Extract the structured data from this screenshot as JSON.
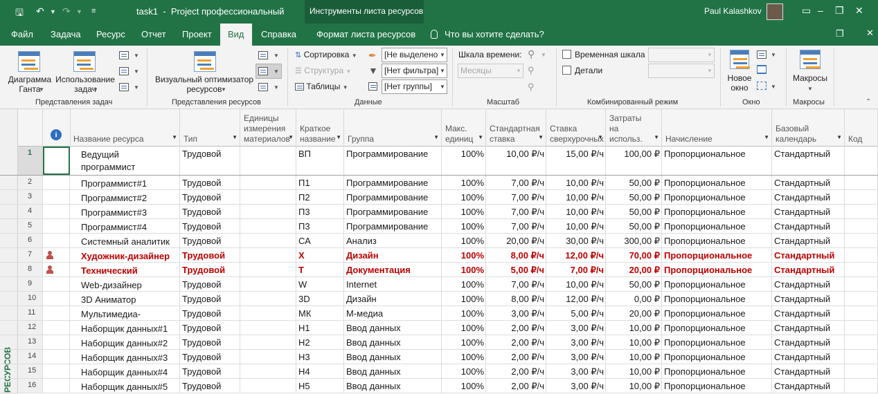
{
  "window": {
    "file_title": "task1",
    "separator": "-",
    "app_name": "Project профессиональный",
    "context_tab_header": "Инструменты листа ресурсов",
    "user_name": "Paul Kalashkov"
  },
  "tabs": [
    "Файл",
    "Задача",
    "Ресурс",
    "Отчет",
    "Проект",
    "Вид",
    "Справка",
    "Формат листа ресурсов"
  ],
  "active_tab": "Вид",
  "tell_me": "Что вы хотите сделать?",
  "ribbon": {
    "task_views": {
      "label": "Представления задач",
      "gantt": "Диаграмма\nГанта",
      "usage": "Использование\nзадач"
    },
    "resource_views": {
      "label": "Представления ресурсов",
      "team_planner": "Визуальный оптимизатор\nресурсов"
    },
    "data": {
      "label": "Данные",
      "sort": "Сортировка",
      "outline": "Структура",
      "tables": "Таблицы",
      "highlight_value": "[Не выделено",
      "filter_value": "[Нет фильтра]",
      "group_value": "[Нет группы]"
    },
    "zoom": {
      "label": "Масштаб",
      "timescale": "Шкала времени:",
      "timescale_value": "Месяцы"
    },
    "split_view": {
      "label": "Комбинированный режим",
      "timeline": "Временная шкала",
      "details": "Детали"
    },
    "window": {
      "label": "Окно",
      "new_window": "Новое\nокно"
    },
    "macros": {
      "label": "Макросы",
      "macros": "Макросы"
    }
  },
  "side_label": "РЕСУРСОВ",
  "columns": [
    "Название ресурса",
    "Тип",
    "Единицы\nизмерения\nматериалов",
    "Краткое\nназвание",
    "Группа",
    "Макс.\nединиц",
    "Стандартная\nставка",
    "Ставка\nсверхурочных",
    "Затраты\nна\nиспольз.",
    "Начисление",
    "Базовый\nкалендарь",
    "Код"
  ],
  "rows": [
    {
      "id": "1",
      "name": "Ведущий\nпрограммист",
      "type": "Трудовой",
      "short": "ВП",
      "group": "Программирование",
      "max": "100%",
      "std": "10,00 ₽/ч",
      "ovt": "15,00 ₽/ч",
      "cost": "100,00 ₽",
      "accrue": "Пропорциональное",
      "cal": "Стандартный",
      "over": false
    },
    {
      "id": "2",
      "name": "Программист#1",
      "type": "Трудовой",
      "short": "П1",
      "group": "Программирование",
      "max": "100%",
      "std": "7,00 ₽/ч",
      "ovt": "10,00 ₽/ч",
      "cost": "50,00 ₽",
      "accrue": "Пропорциональное",
      "cal": "Стандартный",
      "over": false
    },
    {
      "id": "3",
      "name": "Программист#2",
      "type": "Трудовой",
      "short": "П2",
      "group": "Программирование",
      "max": "100%",
      "std": "7,00 ₽/ч",
      "ovt": "10,00 ₽/ч",
      "cost": "50,00 ₽",
      "accrue": "Пропорциональное",
      "cal": "Стандартный",
      "over": false
    },
    {
      "id": "4",
      "name": "Программист#3",
      "type": "Трудовой",
      "short": "П3",
      "group": "Программирование",
      "max": "100%",
      "std": "7,00 ₽/ч",
      "ovt": "10,00 ₽/ч",
      "cost": "50,00 ₽",
      "accrue": "Пропорциональное",
      "cal": "Стандартный",
      "over": false
    },
    {
      "id": "5",
      "name": "Программист#4",
      "type": "Трудовой",
      "short": "П3",
      "group": "Программирование",
      "max": "100%",
      "std": "7,00 ₽/ч",
      "ovt": "10,00 ₽/ч",
      "cost": "50,00 ₽",
      "accrue": "Пропорциональное",
      "cal": "Стандартный",
      "over": false
    },
    {
      "id": "6",
      "name": "Системный аналитик",
      "type": "Трудовой",
      "short": "СА",
      "group": "Анализ",
      "max": "100%",
      "std": "20,00 ₽/ч",
      "ovt": "30,00 ₽/ч",
      "cost": "300,00 ₽",
      "accrue": "Пропорциональное",
      "cal": "Стандартный",
      "over": false
    },
    {
      "id": "7",
      "name": "Художник-дизайнер",
      "type": "Трудовой",
      "short": "Х",
      "group": "Дизайн",
      "max": "100%",
      "std": "8,00 ₽/ч",
      "ovt": "12,00 ₽/ч",
      "cost": "70,00 ₽",
      "accrue": "Пропорциональное",
      "cal": "Стандартный",
      "over": true
    },
    {
      "id": "8",
      "name": "Технический писатель",
      "type": "Трудовой",
      "short": "Т",
      "group": "Документация",
      "max": "100%",
      "std": "5,00 ₽/ч",
      "ovt": "7,00 ₽/ч",
      "cost": "20,00 ₽",
      "accrue": "Пропорциональное",
      "cal": "Стандартный",
      "over": true
    },
    {
      "id": "9",
      "name": "Web-дизайнер",
      "type": "Трудовой",
      "short": "W",
      "group": "Internet",
      "max": "100%",
      "std": "7,00 ₽/ч",
      "ovt": "10,00 ₽/ч",
      "cost": "50,00 ₽",
      "accrue": "Пропорциональное",
      "cal": "Стандартный",
      "over": false
    },
    {
      "id": "10",
      "name": "3D Аниматор",
      "type": "Трудовой",
      "short": "3D",
      "group": "Дизайн",
      "max": "100%",
      "std": "8,00 ₽/ч",
      "ovt": "12,00 ₽/ч",
      "cost": "0,00 ₽",
      "accrue": "Пропорциональное",
      "cal": "Стандартный",
      "over": false
    },
    {
      "id": "11",
      "name": "Мультимедиа-корректор",
      "type": "Трудовой",
      "short": "МК",
      "group": "М-медиа",
      "max": "100%",
      "std": "3,00 ₽/ч",
      "ovt": "5,00 ₽/ч",
      "cost": "20,00 ₽",
      "accrue": "Пропорциональное",
      "cal": "Стандартный",
      "over": false
    },
    {
      "id": "12",
      "name": "Наборщик данных#1",
      "type": "Трудовой",
      "short": "Н1",
      "group": "Ввод данных",
      "max": "100%",
      "std": "2,00 ₽/ч",
      "ovt": "3,00 ₽/ч",
      "cost": "10,00 ₽",
      "accrue": "Пропорциональное",
      "cal": "Стандартный",
      "over": false
    },
    {
      "id": "13",
      "name": "Наборщик данных#2",
      "type": "Трудовой",
      "short": "Н2",
      "group": "Ввод данных",
      "max": "100%",
      "std": "2,00 ₽/ч",
      "ovt": "3,00 ₽/ч",
      "cost": "10,00 ₽",
      "accrue": "Пропорциональное",
      "cal": "Стандартный",
      "over": false
    },
    {
      "id": "14",
      "name": "Наборщик данных#3",
      "type": "Трудовой",
      "short": "Н3",
      "group": "Ввод данных",
      "max": "100%",
      "std": "2,00 ₽/ч",
      "ovt": "3,00 ₽/ч",
      "cost": "10,00 ₽",
      "accrue": "Пропорциональное",
      "cal": "Стандартный",
      "over": false
    },
    {
      "id": "15",
      "name": "Наборщик данных#4",
      "type": "Трудовой",
      "short": "Н4",
      "group": "Ввод данных",
      "max": "100%",
      "std": "2,00 ₽/ч",
      "ovt": "3,00 ₽/ч",
      "cost": "10,00 ₽",
      "accrue": "Пропорциональное",
      "cal": "Стандартный",
      "over": false
    },
    {
      "id": "16",
      "name": "Наборщик данных#5",
      "type": "Трудовой",
      "short": "Н5",
      "group": "Ввод данных",
      "max": "100%",
      "std": "2,00 ₽/ч",
      "ovt": "3,00 ₽/ч",
      "cost": "10,00 ₽",
      "accrue": "Пропорциональное",
      "cal": "Стандартный",
      "over": false
    }
  ],
  "colors": {
    "accent": "#217346",
    "overallocated": "#c00000"
  }
}
